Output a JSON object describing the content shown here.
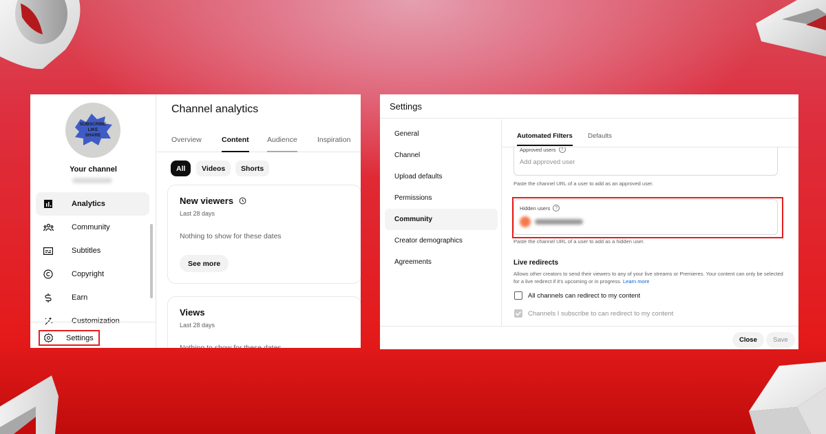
{
  "left_panel": {
    "sidebar": {
      "avatar_text": [
        "SUBSCRIBE",
        "LIKE",
        "SHARE"
      ],
      "channel_label": "Your channel",
      "items": [
        {
          "label": "Analytics",
          "icon": "analytics-icon",
          "active": true
        },
        {
          "label": "Community",
          "icon": "community-icon"
        },
        {
          "label": "Subtitles",
          "icon": "subtitles-icon"
        },
        {
          "label": "Copyright",
          "icon": "copyright-icon"
        },
        {
          "label": "Earn",
          "icon": "dollar-icon"
        },
        {
          "label": "Customization",
          "icon": "magic-wand-icon"
        }
      ],
      "settings_label": "Settings"
    },
    "analytics": {
      "title": "Channel analytics",
      "tabs": [
        "Overview",
        "Content",
        "Audience",
        "Inspiration"
      ],
      "active_tab": "Content",
      "chips": [
        "All",
        "Videos",
        "Shorts"
      ],
      "active_chip": "All",
      "cards": [
        {
          "title": "New viewers",
          "subtitle": "Last 28 days",
          "empty": "Nothing to show for these dates",
          "button": "See more"
        },
        {
          "title": "Views",
          "subtitle": "Last 28 days",
          "empty": "Nothing to show for these dates"
        }
      ]
    }
  },
  "right_panel": {
    "title": "Settings",
    "nav": [
      "General",
      "Channel",
      "Upload defaults",
      "Permissions",
      "Community",
      "Creator demographics",
      "Agreements"
    ],
    "active_nav": "Community",
    "tabs": [
      "Automated Filters",
      "Defaults"
    ],
    "active_tab": "Automated Filters",
    "approved_users": {
      "label": "Approved users",
      "placeholder": "Add approved user",
      "help": "Paste the channel URL of a user to add as an approved user."
    },
    "hidden_users": {
      "label": "Hidden users",
      "help": "Paste the channel URL of a user to add as a hidden user."
    },
    "live_redirects": {
      "title": "Live redirects",
      "description": "Allows other creators to send their viewers to any of your live streams or Premieres. Your content can only be selected for a live redirect if it's upcoming or in progress.",
      "learn_more": "Learn more",
      "options": [
        {
          "label": "All channels can redirect to my content",
          "checked": false
        },
        {
          "label": "Channels I subscribe to can redirect to my content",
          "checked": true,
          "disabled": true
        }
      ]
    },
    "footer": {
      "close": "Close",
      "save": "Save"
    }
  },
  "colors": {
    "highlight": "#e41e1e",
    "link": "#065fd4",
    "background": "#e41a1a"
  }
}
